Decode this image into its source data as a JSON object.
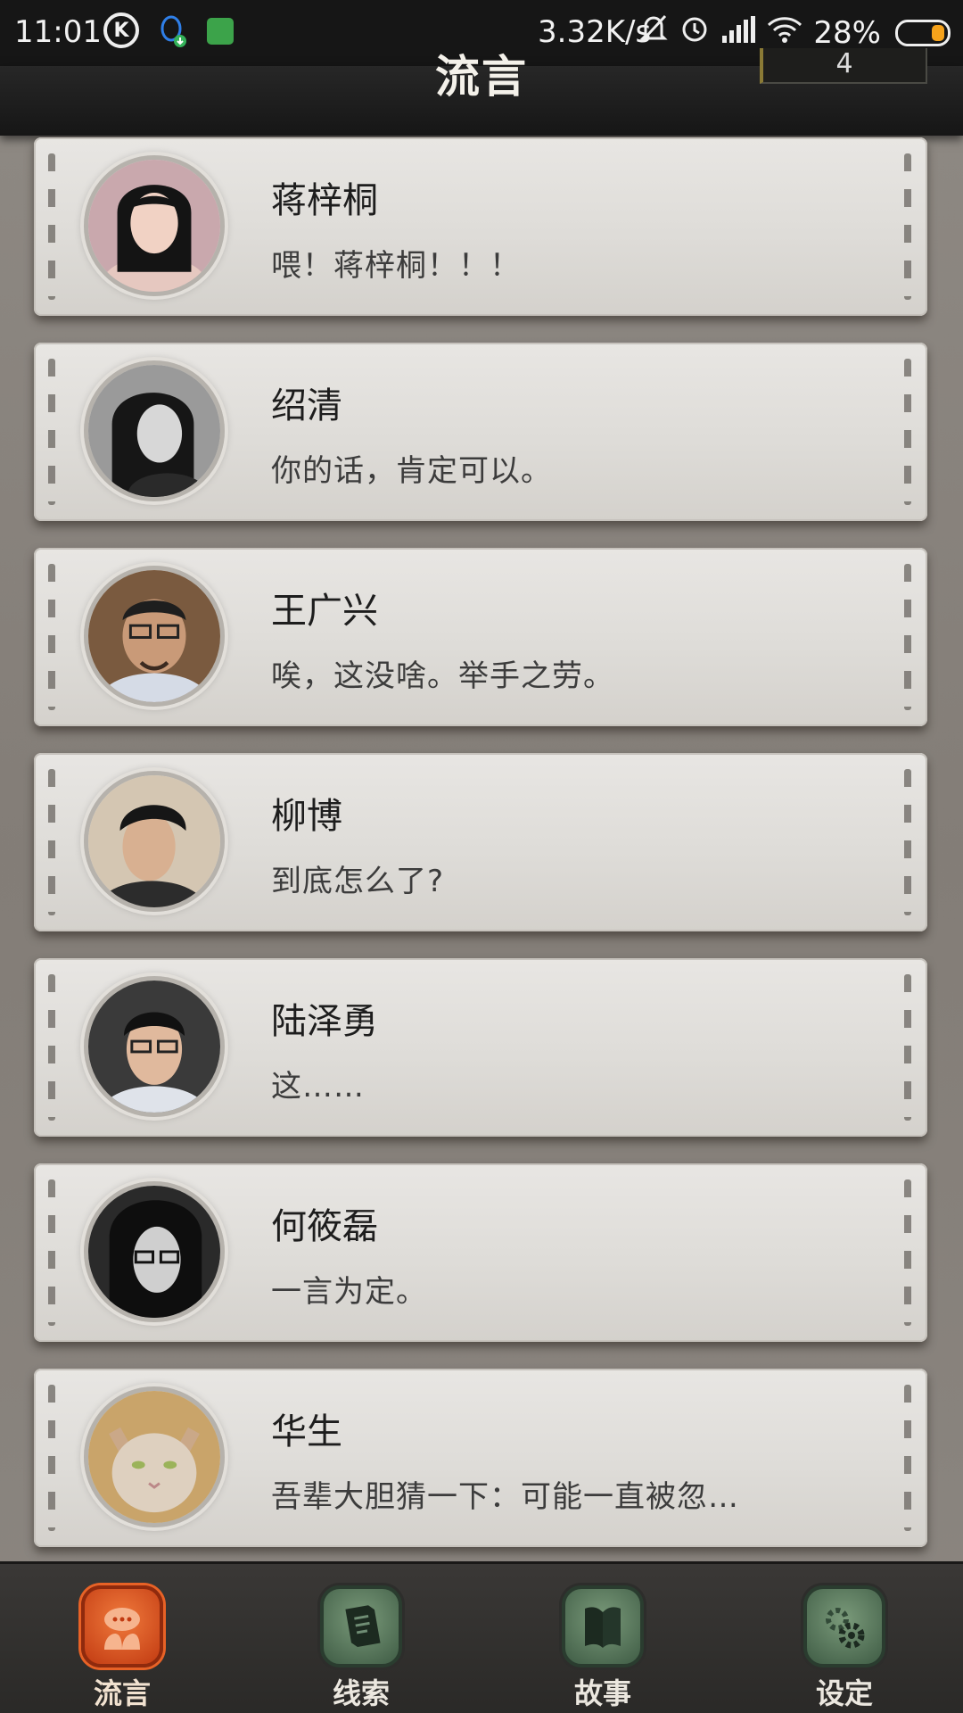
{
  "status_bar": {
    "time": "11:01",
    "speed": "3.32K/s",
    "battery": "28%",
    "battery_level": 0.28,
    "icons": [
      "k-icon",
      "qq-download-icon",
      "app-icon",
      "mute-bell-icon",
      "alarm-icon",
      "signal-icon",
      "wifi-icon",
      "battery-icon"
    ]
  },
  "header": {
    "title": "流言",
    "counter": "4"
  },
  "messages": [
    {
      "name": "蒋梓桐",
      "text": "喂！蒋梓桐！！！"
    },
    {
      "name": "绍清",
      "text": "你的话，肯定可以。"
    },
    {
      "name": "王广兴",
      "text": "唉，这没啥。举手之劳。"
    },
    {
      "name": "柳博",
      "text": "到底怎么了?"
    },
    {
      "name": "陆泽勇",
      "text": "这……"
    },
    {
      "name": "何筱磊",
      "text": "一言为定。"
    },
    {
      "name": "华生",
      "text": "吾辈大胆猜一下：可能一直被忽…"
    }
  ],
  "tabs": [
    {
      "label": "流言",
      "icon": "rumor-chat-icon",
      "active": true
    },
    {
      "label": "线索",
      "icon": "clue-paper-icon",
      "active": false
    },
    {
      "label": "故事",
      "icon": "story-book-icon",
      "active": false
    },
    {
      "label": "设定",
      "icon": "settings-gear-icon",
      "active": false
    }
  ],
  "colors": {
    "active_tab": "#d9501c",
    "inactive_tab": "#5b7b60",
    "card": "#e3e1de"
  }
}
